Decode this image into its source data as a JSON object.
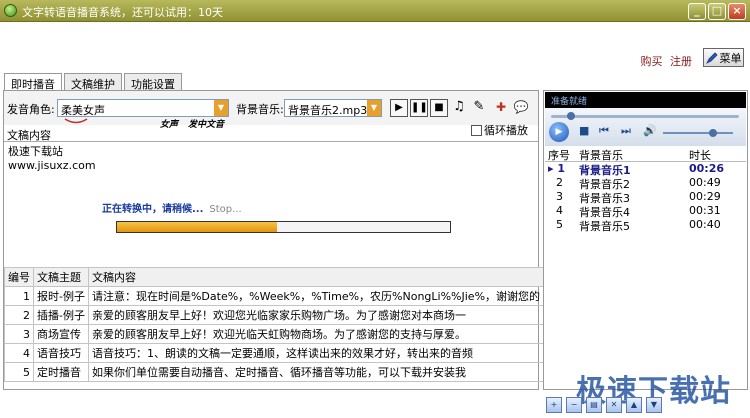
{
  "window": {
    "title": "文字转语音播音系统，还可以试用：10天",
    "min_label": "_",
    "max_label": "□",
    "close_label": "×"
  },
  "header": {
    "buy_label": "购买",
    "register_label": "注册",
    "menu_label": "菜单"
  },
  "tabs": [
    {
      "label": "即时播音",
      "active": true
    },
    {
      "label": "文稿维护",
      "active": false
    },
    {
      "label": "功能设置",
      "active": false
    }
  ],
  "toolbar": {
    "voice_label": "发音角色:",
    "voice_value": "柔美女声",
    "voice_hint_1": "女声",
    "voice_hint_2": "发中文音",
    "music_label": "背景音乐:",
    "music_value": "背景音乐2.mp3",
    "loop_label": "循环播放"
  },
  "content": {
    "label": "文稿内容",
    "lines": [
      "极速下载站",
      "www.jisuxz.com"
    ]
  },
  "progress": {
    "text": "正在转换中，请稍候...",
    "stop_label": "Stop...",
    "percent": 48
  },
  "table": {
    "headers": [
      "编号",
      "文稿主题",
      "文稿内容"
    ],
    "rows": [
      [
        "1",
        "报时-例子",
        "请注意：现在时间是%Date%，%Week%，%Time%，农历%NongLi%%Jie%，谢谢您的"
      ],
      [
        "2",
        "插播-例子",
        "亲爱的顾客朋友早上好！欢迎您光临家家乐购物广场。为了感谢您对本商场一"
      ],
      [
        "3",
        "商场宣传",
        "亲爱的顾客朋友早上好！欢迎光临天虹购物商场。为了感谢您的支持与厚爱。"
      ],
      [
        "4",
        "语音技巧",
        "语音技巧：1、朗读的文稿一定要通顺，这样读出来的效果才好，转出来的音频"
      ],
      [
        "5",
        "定时播音",
        "如果你们单位需要自动播音、定时播音、循环播音等功能，可以下载并安装我"
      ]
    ]
  },
  "player": {
    "status": "准备就绪"
  },
  "playlist": {
    "headers": [
      "序号",
      "背景音乐",
      "时长"
    ],
    "rows": [
      {
        "index": "1",
        "name": "背景音乐1",
        "duration": "00:26",
        "active": true
      },
      {
        "index": "2",
        "name": "背景音乐2",
        "duration": "00:49",
        "active": false
      },
      {
        "index": "3",
        "name": "背景音乐3",
        "duration": "00:29",
        "active": false
      },
      {
        "index": "4",
        "name": "背景音乐4",
        "duration": "00:31",
        "active": false
      },
      {
        "index": "5",
        "name": "背景音乐5",
        "duration": "00:40",
        "active": false
      }
    ]
  },
  "watermark": "极速下载站"
}
